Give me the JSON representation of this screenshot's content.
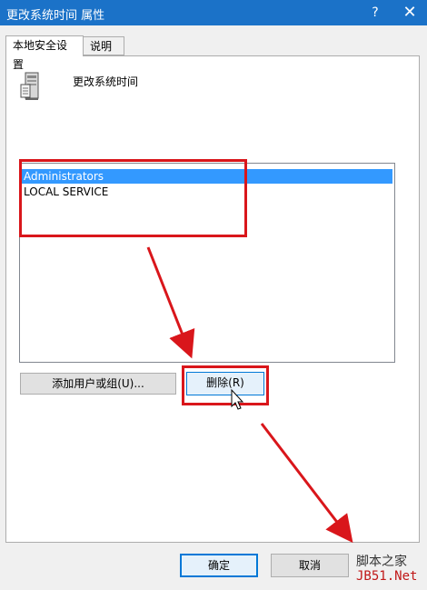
{
  "window": {
    "title": "更改系统时间 属性",
    "help_label": "?",
    "close_label": "✕"
  },
  "tabs": [
    {
      "label": "本地安全设置",
      "active": true
    },
    {
      "label": "说明",
      "active": false
    }
  ],
  "policy": {
    "icon": "server-policy-icon",
    "name": "更改系统时间"
  },
  "members": [
    {
      "label": "Administrators",
      "selected": true
    },
    {
      "label": "LOCAL SERVICE",
      "selected": false
    }
  ],
  "buttons": {
    "add": "添加用户或组(U)...",
    "remove": "删除(R)",
    "ok": "确定",
    "cancel": "取消"
  },
  "annotations": {
    "color": "#d9161b"
  },
  "watermark": {
    "line1": "脚本之家",
    "line2": "JB51.Net"
  }
}
